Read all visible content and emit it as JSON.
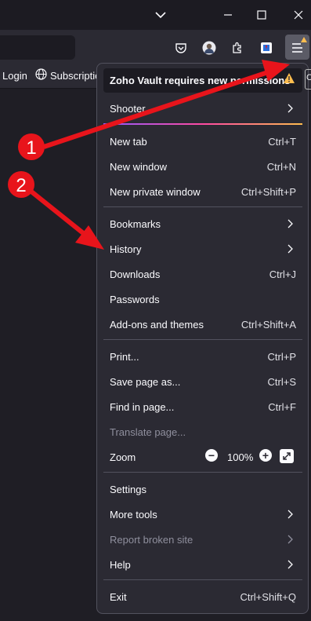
{
  "bookmarks": [
    {
      "label": "Login",
      "icon": "none"
    },
    {
      "label": "Subscription",
      "icon": "globe-icon"
    }
  ],
  "edge_letter": "C",
  "notification": "Zoho Vault requires new permissions",
  "menu": {
    "shooter": "Shooter",
    "new_tab": {
      "label": "New tab",
      "shortcut": "Ctrl+T"
    },
    "new_window": {
      "label": "New window",
      "shortcut": "Ctrl+N"
    },
    "new_private_window": {
      "label": "New private window",
      "shortcut": "Ctrl+Shift+P"
    },
    "bookmarks": "Bookmarks",
    "history": "History",
    "downloads": {
      "label": "Downloads",
      "shortcut": "Ctrl+J"
    },
    "passwords": "Passwords",
    "addons": {
      "label": "Add-ons and themes",
      "shortcut": "Ctrl+Shift+A"
    },
    "print": {
      "label": "Print...",
      "shortcut": "Ctrl+P"
    },
    "save_page": {
      "label": "Save page as...",
      "shortcut": "Ctrl+S"
    },
    "find": {
      "label": "Find in page...",
      "shortcut": "Ctrl+F"
    },
    "translate": "Translate page...",
    "zoom": {
      "label": "Zoom",
      "value": "100%",
      "minus": "−",
      "plus": "+"
    },
    "settings": "Settings",
    "more_tools": "More tools",
    "report": "Report broken site",
    "help": "Help",
    "exit": {
      "label": "Exit",
      "shortcut": "Ctrl+Shift+Q"
    }
  },
  "annotations": {
    "one": "1",
    "two": "2",
    "color": "#e8141b"
  },
  "colors": {
    "panel": "#2b2a33",
    "accent_gradient": [
      "#9059ff",
      "#ff4aa2",
      "#ffbd4f"
    ],
    "warning": "#ffbd4f"
  }
}
